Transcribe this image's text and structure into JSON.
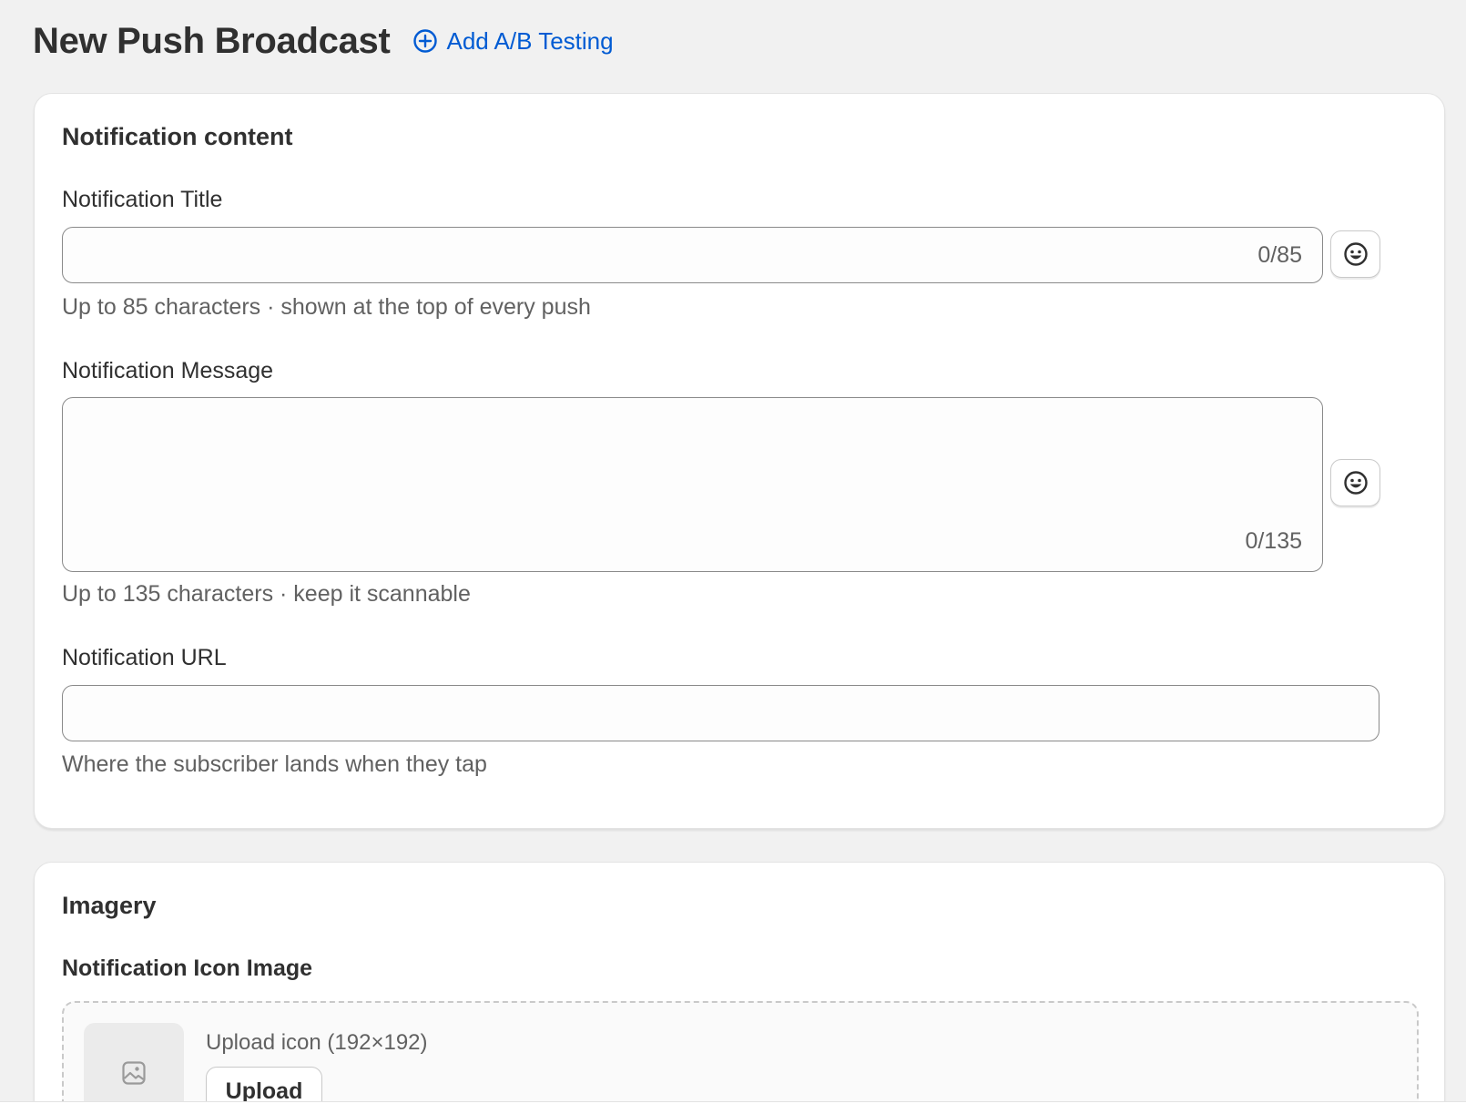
{
  "header": {
    "title": "New Push Broadcast",
    "ab_testing_label": "Add A/B Testing",
    "ab_icon": "plus-circle-icon",
    "accent_color": "#005bd3"
  },
  "notification_content": {
    "section_title": "Notification content",
    "title_field": {
      "label": "Notification Title",
      "value": "",
      "counter": "0/85",
      "help": "Up to 85 characters · shown at the top of every push",
      "emoji_icon": "smiley-icon"
    },
    "message_field": {
      "label": "Notification Message",
      "value": "",
      "counter": "0/135",
      "help": "Up to 135 characters · keep it scannable",
      "emoji_icon": "smiley-icon"
    },
    "url_field": {
      "label": "Notification URL",
      "value": "",
      "help": "Where the subscriber lands when they tap"
    }
  },
  "imagery": {
    "section_title": "Imagery",
    "icon_image": {
      "label": "Notification Icon Image",
      "upload_text": "Upload icon (192×192)",
      "upload_button": "Upload",
      "placeholder_icon": "image-icon"
    }
  }
}
